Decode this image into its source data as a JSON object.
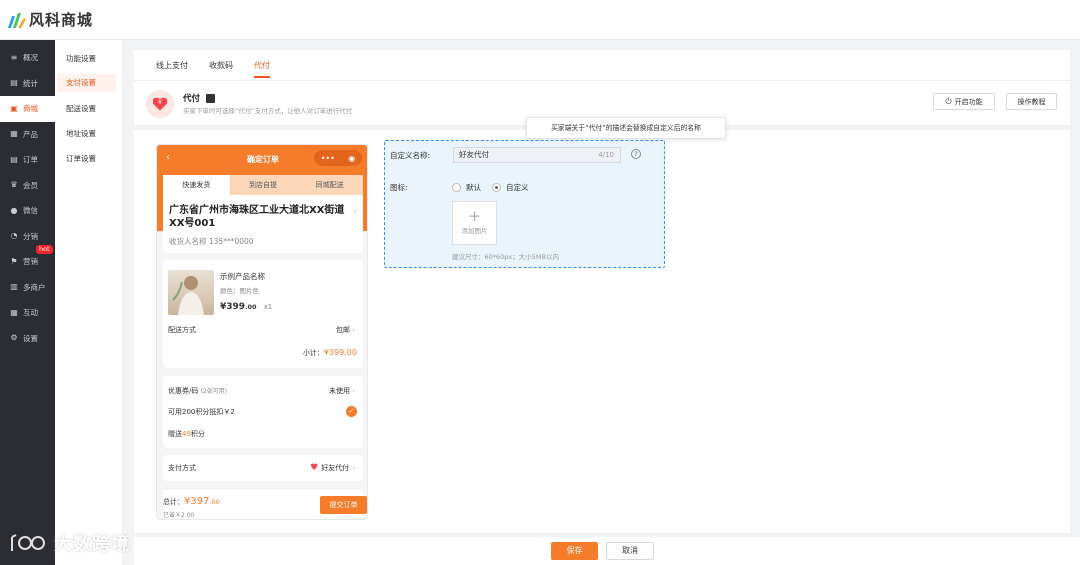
{
  "brand": {
    "name": "风科商城"
  },
  "nav": [
    {
      "label": "概况",
      "icon": "layers-icon",
      "glyph": "≡"
    },
    {
      "label": "统计",
      "icon": "chart-icon",
      "glyph": "▤"
    },
    {
      "label": "商城",
      "icon": "shop-icon",
      "glyph": "▣"
    },
    {
      "label": "产品",
      "icon": "grid-icon",
      "glyph": "▦"
    },
    {
      "label": "订单",
      "icon": "order-icon",
      "glyph": "▤"
    },
    {
      "label": "会员",
      "icon": "crown-icon",
      "glyph": "♛"
    },
    {
      "label": "微信",
      "icon": "wechat-icon",
      "glyph": "●"
    },
    {
      "label": "分销",
      "icon": "share-icon",
      "glyph": "◔"
    },
    {
      "label": "营销",
      "icon": "flag-icon",
      "glyph": "⚑",
      "badge": "hot"
    },
    {
      "label": "多商户",
      "icon": "store-icon",
      "glyph": "▥"
    },
    {
      "label": "互动",
      "icon": "interact-icon",
      "glyph": "▦"
    },
    {
      "label": "设置",
      "icon": "gear-icon",
      "glyph": "⚙"
    }
  ],
  "subnav": [
    "功能设置",
    "支付设置",
    "配送设置",
    "地址设置",
    "订单设置"
  ],
  "tabs": [
    "线上支付",
    "收款码",
    "代付"
  ],
  "pay": {
    "title": "代付",
    "desc": "买家下单时可选择“代付”支付方式，让他人对订单进行代付",
    "enable_label": "开启功能",
    "tutorial_label": "操作教程"
  },
  "tooltip": "买家端关于“代付”的描述会替换成自定义后的名称",
  "phone": {
    "title": "确定订单",
    "tabs": [
      "快速发货",
      "到店自提",
      "同城配送"
    ],
    "address": "广东省广州市海珠区工业大道北XX街道XX号001",
    "receiver": "收货人名称   135***0000",
    "product_name": "示例产品名称",
    "product_color": "颜色：图片色",
    "price_main": "¥399",
    "price_dec": ".00",
    "qty": "x1",
    "shipping_label": "配送方式",
    "shipping_value": "包邮",
    "subtotal_label": "小计：",
    "subtotal_value": "¥399.00",
    "coupon_label": "优惠券/码",
    "coupon_hint": "(2张可用)",
    "coupon_value": "未使用",
    "points_label": "可用200积分抵扣￥2",
    "gift_pre": "赠送",
    "gift_num": "49",
    "gift_post": "积分",
    "pay_label": "支付方式",
    "pay_value": "好友代付",
    "total_label": "总计：",
    "total_value": "¥397",
    "total_dec": ".00",
    "saved": "已省￥2.00",
    "submit": "提交订单"
  },
  "form": {
    "name_label": "自定义名称:",
    "name_value": "好友代付",
    "name_count": "4/10",
    "icon_label": "图标:",
    "radio_default": "默认",
    "radio_custom": "自定义",
    "upload_label": "添加图片",
    "hint": "建议尺寸：60*60px；大小5MB以内"
  },
  "footer": {
    "save": "保存",
    "cancel": "取消"
  },
  "watermark": "大数跨境",
  "colors": {
    "accent": "#f57c2a",
    "sidebar": "#2b2d33",
    "highlight": "#f0541e"
  }
}
